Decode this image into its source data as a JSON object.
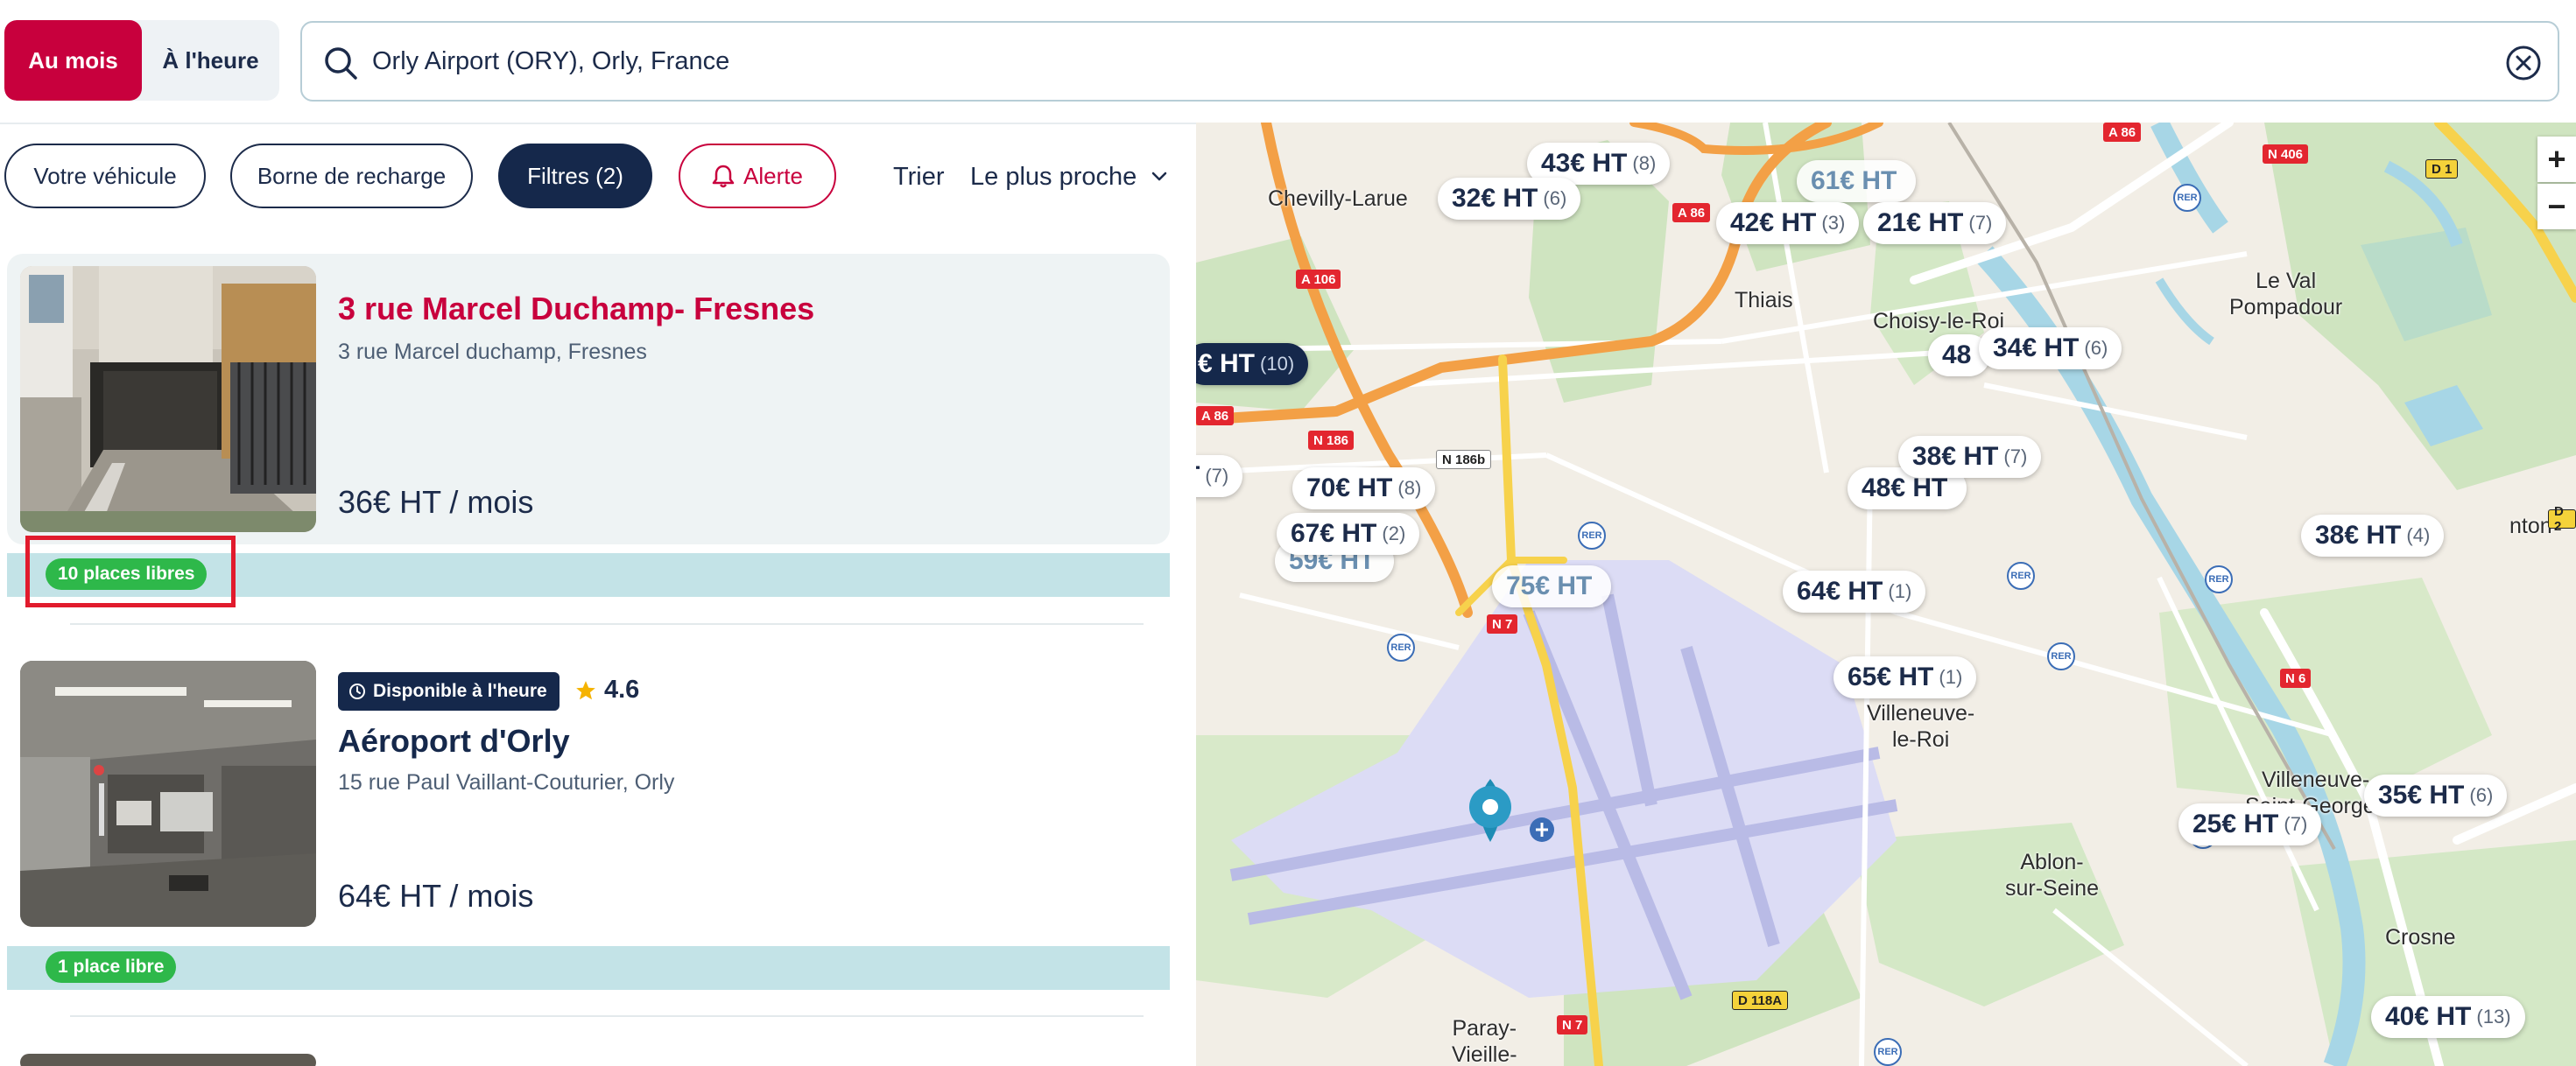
{
  "mode": {
    "monthly": "Au mois",
    "hourly": "À l'heure"
  },
  "search": {
    "value": "Orly Airport (ORY), Orly, France"
  },
  "filters": {
    "vehicle": "Votre véhicule",
    "charger": "Borne de recharge",
    "filters": "Filtres (2)",
    "alert": "Alerte",
    "sort_label": "Trier",
    "sort_value": "Le plus proche"
  },
  "listings": [
    {
      "title": "3 rue Marcel Duchamp- Fresnes",
      "address": "3 rue Marcel duchamp, Fresnes",
      "price": "36€ HT / mois",
      "availability": "10 places libres"
    },
    {
      "badge": "Disponible à l'heure",
      "rating": "4.6",
      "title": "Aéroport d'Orly",
      "address": "15 rue Paul Vaillant-Couturier, Orly",
      "price": "64€ HT / mois",
      "availability": "1 place libre"
    }
  ],
  "map": {
    "markers": [
      {
        "price": "43€ HT",
        "count": "(8)"
      },
      {
        "price": "32€ HT",
        "count": "(6)"
      },
      {
        "price": "61€ HT",
        "count": ""
      },
      {
        "price": "42€ HT",
        "count": "(3)"
      },
      {
        "price": "21€ HT",
        "count": "(7)"
      },
      {
        "price": "€ HT",
        "count": "(10)"
      },
      {
        "price": "48",
        "count": ""
      },
      {
        "price": "34€ HT",
        "count": "(6)"
      },
      {
        "price": "38€ HT",
        "count": "(7)"
      },
      {
        "price": "48€ HT",
        "count": ""
      },
      {
        "price": "T",
        "count": "(7)"
      },
      {
        "price": "70€ HT",
        "count": "(8)"
      },
      {
        "price": "67€ HT",
        "count": "(2)"
      },
      {
        "price": "59€ HT",
        "count": ""
      },
      {
        "price": "75€ HT",
        "count": ""
      },
      {
        "price": "64€ HT",
        "count": "(1)"
      },
      {
        "price": "38€ HT",
        "count": "(4)"
      },
      {
        "price": "65€ HT",
        "count": "(1)"
      },
      {
        "price": "35€ HT",
        "count": "(6)"
      },
      {
        "price": "25€ HT",
        "count": "(7)"
      },
      {
        "price": "40€ HT",
        "count": "(13)"
      }
    ],
    "places": {
      "chevilly": "Chevilly-Larue",
      "thiais": "Thiais",
      "choisy": "Choisy-le-Roi",
      "levalpompadour": "Le Val\nPompadour",
      "villeneuveroi": "Villeneuve-\nle-Roi",
      "villeneuvesg": "Villeneuve-\nSaint-Georges",
      "ablon": "Ablon-\nsur-Seine",
      "crosne": "Crosne",
      "paray": "Paray-\nVieille-",
      "nton": "nton"
    },
    "roads": [
      "A 86",
      "N 406",
      "D 1",
      "A 86",
      "A 106",
      "A 86",
      "N 186",
      "N 186b",
      "N 7",
      "N 6",
      "D 118A",
      "N 7",
      "D 2"
    ],
    "rer": "RER",
    "zoom_in": "+",
    "zoom_out": "−"
  }
}
